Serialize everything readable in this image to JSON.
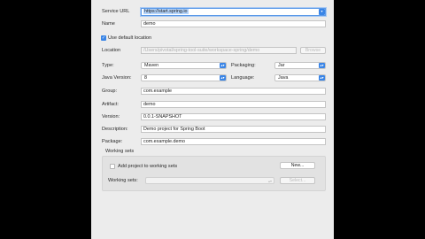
{
  "service_url": {
    "label": "Service URL",
    "value": "https://start.spring.io"
  },
  "name": {
    "label": "Name",
    "value": "demo"
  },
  "use_default_location": {
    "label": "Use default location",
    "checked": true
  },
  "location": {
    "label": "Location",
    "value": "/Users/pivotal/spring-tool-suite/workspace-spring/demo",
    "browse": "Browse"
  },
  "type": {
    "label": "Type:",
    "value": "Maven"
  },
  "packaging": {
    "label": "Packaging:",
    "value": "Jar"
  },
  "java_version": {
    "label": "Java Version:",
    "value": "8"
  },
  "language": {
    "label": "Language:",
    "value": "Java"
  },
  "group": {
    "label": "Group:",
    "value": "com.example"
  },
  "artifact": {
    "label": "Artifact:",
    "value": "demo"
  },
  "version": {
    "label": "Version:",
    "value": "0.0.1-SNAPSHOT"
  },
  "description": {
    "label": "Description:",
    "value": "Demo project for Spring Boot"
  },
  "package": {
    "label": "Package:",
    "value": "com.example.demo"
  },
  "working_sets": {
    "title": "Working sets",
    "add_label": "Add project to working sets",
    "add_checked": false,
    "new_button": "New...",
    "sets_label": "Working sets:",
    "select_button": "Select..."
  },
  "colors": {
    "accent": "#3a85e6",
    "dialog_bg": "#ececec",
    "backdrop": "#000000"
  }
}
